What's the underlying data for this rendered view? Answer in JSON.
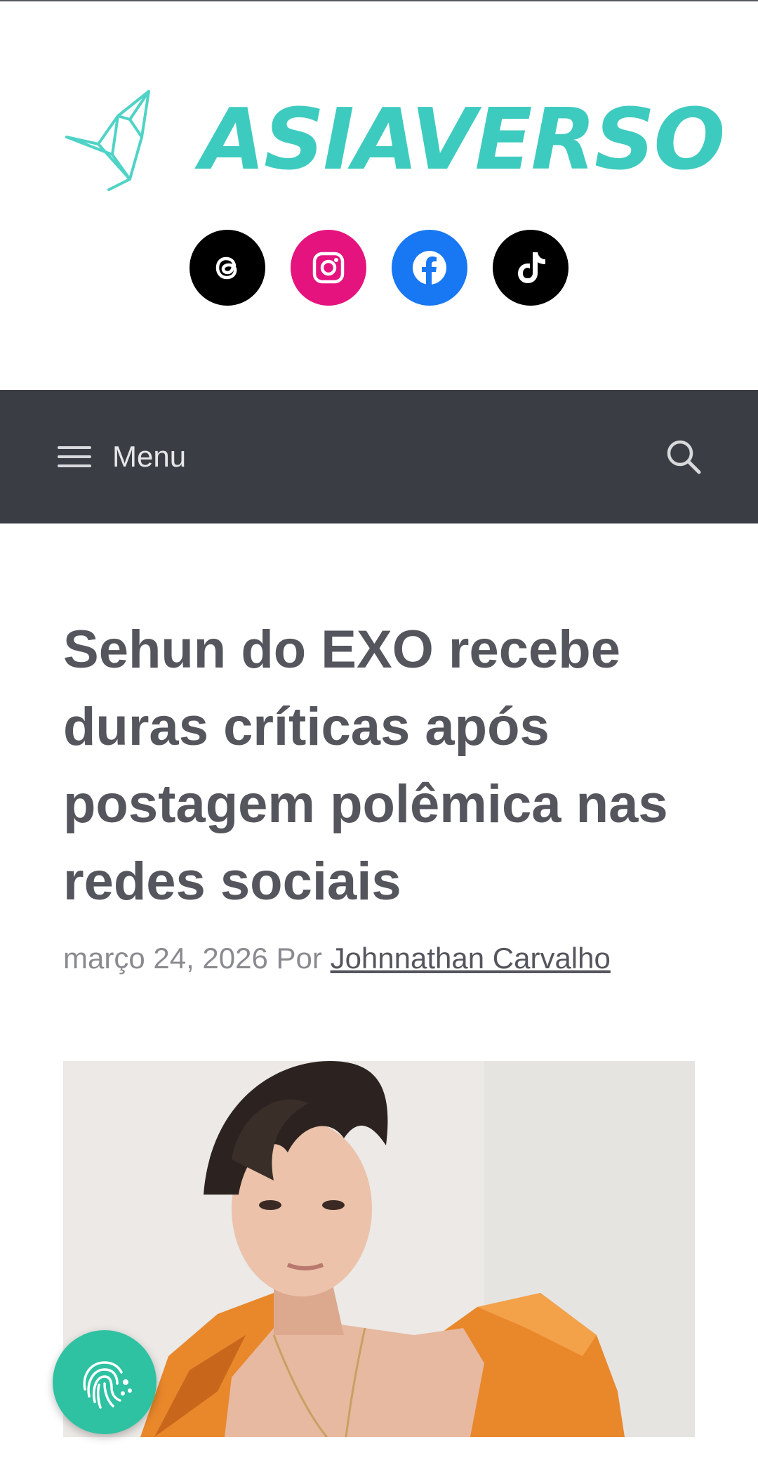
{
  "brand": {
    "name": "ASIAVERSO",
    "color": "#3ecbbf"
  },
  "socials": [
    {
      "name": "threads",
      "icon": "threads-icon",
      "color": "#000000"
    },
    {
      "name": "instagram",
      "icon": "instagram-icon",
      "color": "#e4137e"
    },
    {
      "name": "facebook",
      "icon": "facebook-icon",
      "color": "#1877f2"
    },
    {
      "name": "tiktok",
      "icon": "tiktok-icon",
      "color": "#000000"
    }
  ],
  "nav": {
    "menu_label": "Menu",
    "menu_icon": "hamburger-icon",
    "search_icon": "search-icon",
    "background": "#3a3d44"
  },
  "article": {
    "title": "Sehun do EXO recebe duras críticas após postagem polêmica nas redes sociais",
    "date": "março 24, 2026",
    "by": "Por",
    "author": "Johnnathan Carvalho"
  },
  "cookie_button": {
    "icon": "fingerprint-cookie-icon",
    "color": "#2ec2a2"
  }
}
